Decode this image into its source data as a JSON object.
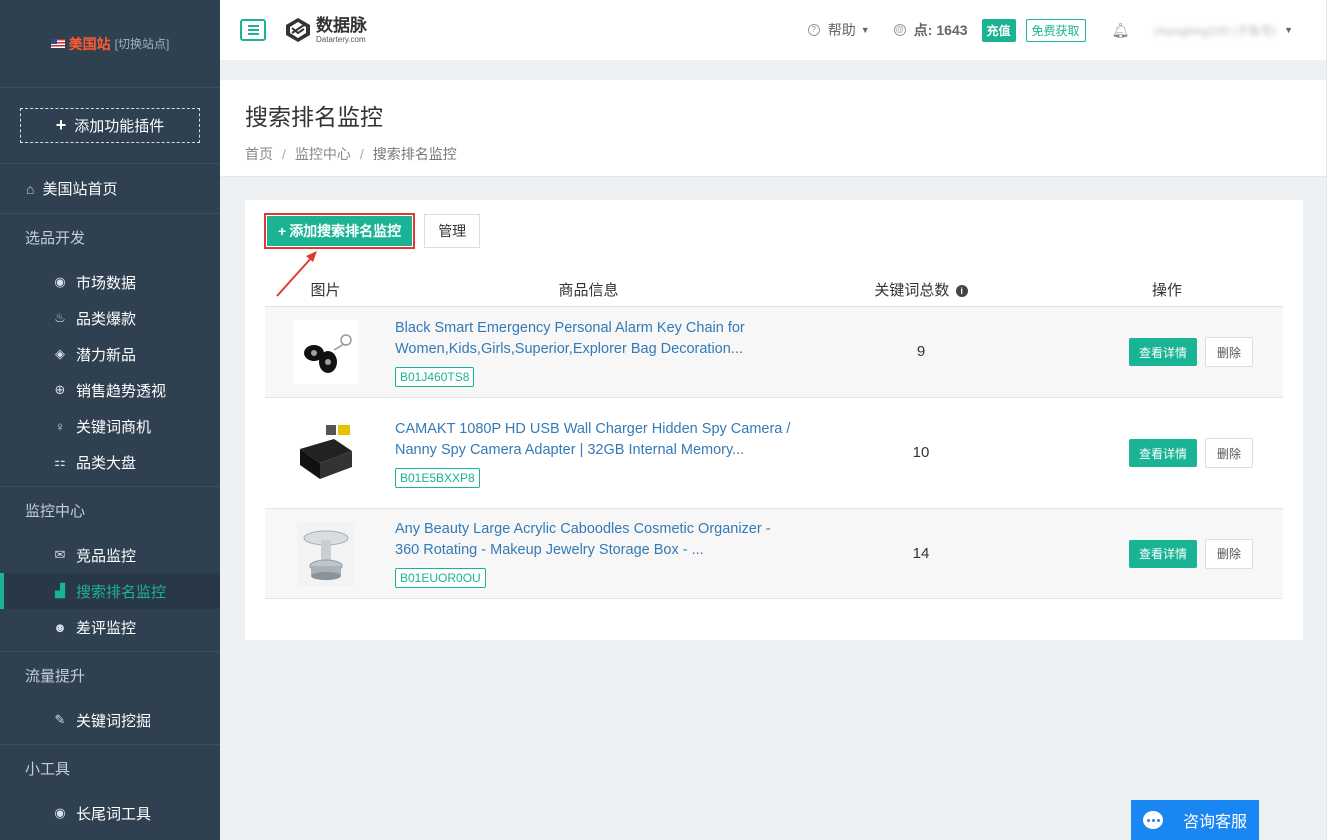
{
  "site": {
    "name": "美国站",
    "switch_label": "[切换站点]"
  },
  "sidebar": {
    "add_plugin": "添加功能插件",
    "home": "美国站首页",
    "sections": [
      {
        "title": "选品开发",
        "items": [
          {
            "label": "市场数据",
            "icon": "globe-icon"
          },
          {
            "label": "品类爆款",
            "icon": "fire-icon"
          },
          {
            "label": "潜力新品",
            "icon": "tag-icon"
          },
          {
            "label": "销售趋势透视",
            "icon": "target-icon"
          },
          {
            "label": "关键词商机",
            "icon": "bulb-icon"
          },
          {
            "label": "品类大盘",
            "icon": "grid-icon"
          }
        ]
      },
      {
        "title": "监控中心",
        "items": [
          {
            "label": "竞品监控",
            "icon": "envelope-icon"
          },
          {
            "label": "搜索排名监控",
            "icon": "bar-chart-icon",
            "active": true
          },
          {
            "label": "差评监控",
            "icon": "user-icon"
          }
        ]
      },
      {
        "title": "流量提升",
        "items": [
          {
            "label": "关键词挖掘",
            "icon": "pen-icon"
          }
        ]
      },
      {
        "title": "小工具",
        "items": [
          {
            "label": "长尾词工具",
            "icon": "globe-icon"
          }
        ]
      }
    ]
  },
  "topbar": {
    "logo_cn": "数据脉",
    "logo_en": "Datartery.com",
    "help": "帮助",
    "points_label": "点:",
    "points_value": "1643",
    "recharge": "充值",
    "free_get": "免费获取",
    "username": "changbing100 (子账号)"
  },
  "page": {
    "title": "搜索排名监控",
    "breadcrumb": [
      "首页",
      "监控中心",
      "搜索排名监控"
    ]
  },
  "toolbar": {
    "add_label": "添加搜索排名监控",
    "manage_label": "管理"
  },
  "table": {
    "headers": {
      "image": "图片",
      "info": "商品信息",
      "keywords": "关键词总数",
      "actions": "操作"
    },
    "detail_label": "查看详情",
    "delete_label": "删除",
    "rows": [
      {
        "title": "Black Smart Emergency Personal Alarm Key Chain for Women,Kids,Girls,Superior,Explorer Bag Decoration...",
        "asin": "B01J460TS8",
        "keywords": "9"
      },
      {
        "title": "CAMAKT 1080P HD USB Wall Charger Hidden Spy Camera / Nanny Spy Camera Adapter | 32GB Internal Memory...",
        "asin": "B01E5BXXP8",
        "keywords": "10"
      },
      {
        "title": "Any Beauty Large Acrylic Caboodles Cosmetic Organizer - 360 Rotating - Makeup Jewelry Storage Box - ...",
        "asin": "B01EUOR0OU",
        "keywords": "14"
      }
    ]
  },
  "chat": {
    "label": "咨询客服"
  },
  "colors": {
    "accent": "#1ab394",
    "sidebar": "#2f4050",
    "link": "#337ab7",
    "highlight": "#e03a30",
    "chat": "#1a86f2"
  }
}
